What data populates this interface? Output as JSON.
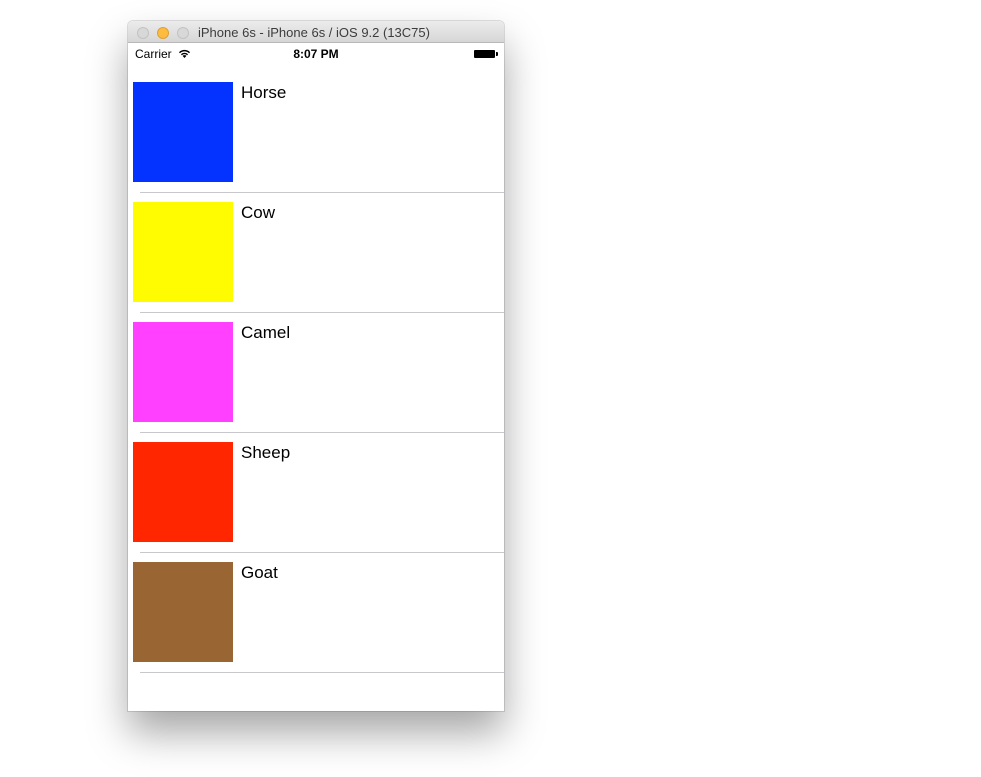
{
  "window": {
    "title": "iPhone 6s - iPhone 6s / iOS 9.2 (13C75)"
  },
  "statusbar": {
    "carrier": "Carrier",
    "time": "8:07 PM"
  },
  "animals": [
    {
      "label": "Horse",
      "color": "#0433ff"
    },
    {
      "label": "Cow",
      "color": "#fffb00"
    },
    {
      "label": "Camel",
      "color": "#ff40ff"
    },
    {
      "label": "Sheep",
      "color": "#ff2600"
    },
    {
      "label": "Goat",
      "color": "#996633"
    }
  ]
}
